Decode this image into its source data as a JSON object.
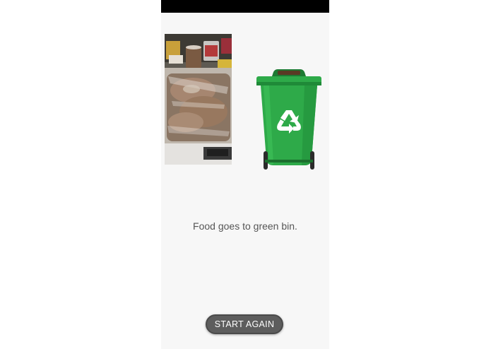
{
  "screen": {
    "message": "Food goes to green bin.",
    "start_button_label": "START AGAIN"
  },
  "food_image": {
    "icon": "food-photo"
  },
  "bin_image": {
    "icon": "green-recycle-bin",
    "color": "#2eaa49"
  },
  "colors": {
    "background": "#f7f7f7",
    "button": "#5d5d5d",
    "text": "#555555"
  }
}
